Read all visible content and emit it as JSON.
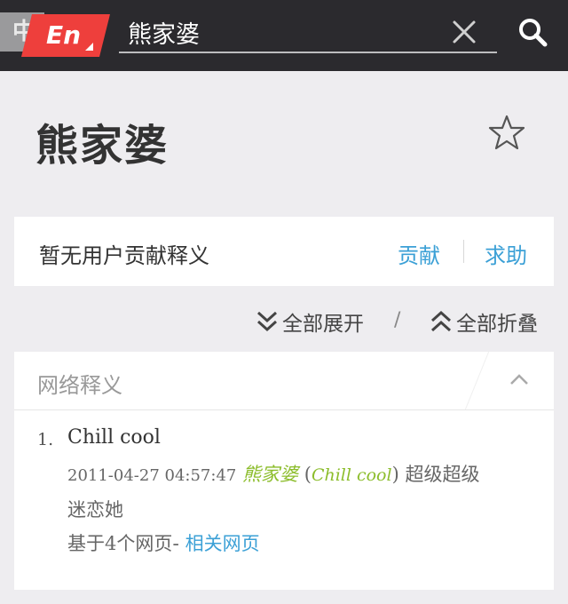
{
  "header": {
    "lang_zh": "中",
    "lang_en": "En",
    "search_value": "熊家婆"
  },
  "word": {
    "title": "熊家婆"
  },
  "contribute": {
    "text": "暂无用户贡献释义",
    "contribute_label": "贡献",
    "help_label": "求助"
  },
  "controls": {
    "expand_all": "全部展开",
    "separator": "/",
    "collapse_all": "全部折叠"
  },
  "web_definitions": {
    "title": "网络释义",
    "items": [
      {
        "number": "1.",
        "term": "Chill cool",
        "date": "2011-04-27 04:57:47",
        "highlight_cn": "熊家婆",
        "paren_open": "(",
        "highlight_en": "Chill cool",
        "paren_close": ")",
        "text_after": "超级超级",
        "text_line2": "迷恋她",
        "source_prefix": "基于",
        "source_count": "4",
        "source_suffix": "个网页-",
        "related_link": "相关网页"
      }
    ]
  },
  "colors": {
    "topbar": "#2b2a2e",
    "en_badge": "#ee3f3c",
    "link": "#3ba0d6",
    "highlight": "#8cbd2c",
    "background": "#eeedf0"
  },
  "icons": [
    "clear-icon",
    "search-icon",
    "star-icon",
    "double-chevron-down-icon",
    "double-chevron-up-icon",
    "chevron-up-icon"
  ]
}
